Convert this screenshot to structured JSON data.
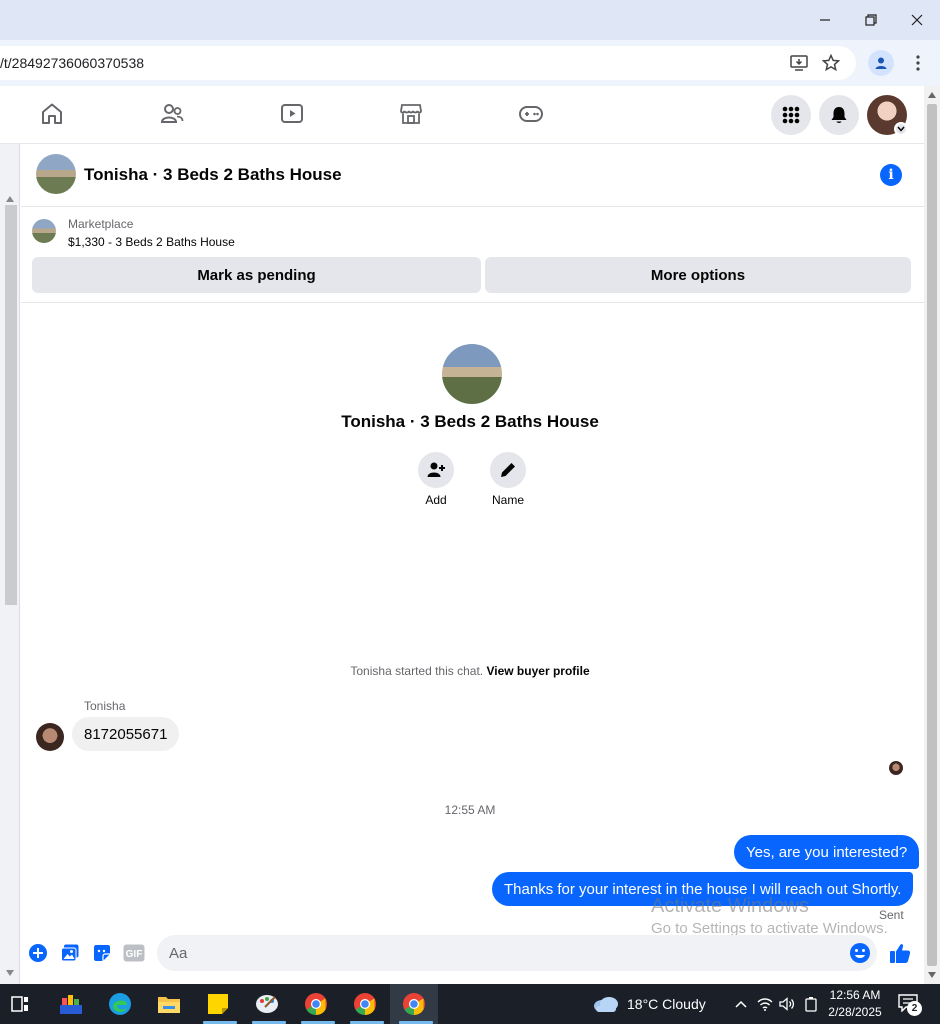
{
  "browser": {
    "url": "/t/28492736060370538",
    "icons": [
      "install-app-icon",
      "bookmark-star-icon",
      "profile-icon",
      "more-menu-icon"
    ]
  },
  "window_controls": [
    "minimize",
    "restore",
    "close"
  ],
  "fb_nav": {
    "items": [
      "home-icon",
      "friends-icon",
      "watch-icon",
      "marketplace-icon",
      "gaming-icon"
    ],
    "right": [
      "menu-grid-icon",
      "notifications-bell-icon",
      "account-avatar"
    ]
  },
  "chat": {
    "title": "Tonisha · 3 Beds 2 Baths House",
    "marketplace": {
      "label": "Marketplace",
      "listing": "$1,330 - 3 Beds 2 Baths House",
      "buttons": {
        "pending": "Mark as pending",
        "more": "More options"
      }
    },
    "intro": {
      "title": "Tonisha · 3 Beds 2 Baths House",
      "actions": {
        "add": "Add",
        "name": "Name"
      }
    },
    "started_prefix": "Tonisha started this chat.",
    "view_profile": "View buyer profile",
    "sender_name": "Tonisha",
    "incoming_message": "8172055671",
    "timestamp": "12:55 AM",
    "outgoing": {
      "first": "Yes, are you interested?",
      "second": "Thanks for your interest in the house I will reach out Shortly."
    },
    "status": "Sent",
    "composer": {
      "placeholder": "Aa",
      "icons": [
        "plus-icon",
        "photo-icon",
        "sticker-icon",
        "gif-icon",
        "emoji-icon",
        "like-thumb-icon"
      ]
    },
    "accent_color": "#0866ff"
  },
  "watermark": {
    "line1": "Activate Windows",
    "line2": "Go to Settings to activate Windows."
  },
  "taskbar": {
    "weather": "18°C  Cloudy",
    "time": "12:56 AM",
    "date": "2/28/2025",
    "notifications": "2",
    "apps": [
      "task-view",
      "app-grid",
      "edge",
      "file-explorer",
      "sticky-notes",
      "paint",
      "chrome-profile-a",
      "chrome-profile-b",
      "chrome-profile-c"
    ]
  }
}
